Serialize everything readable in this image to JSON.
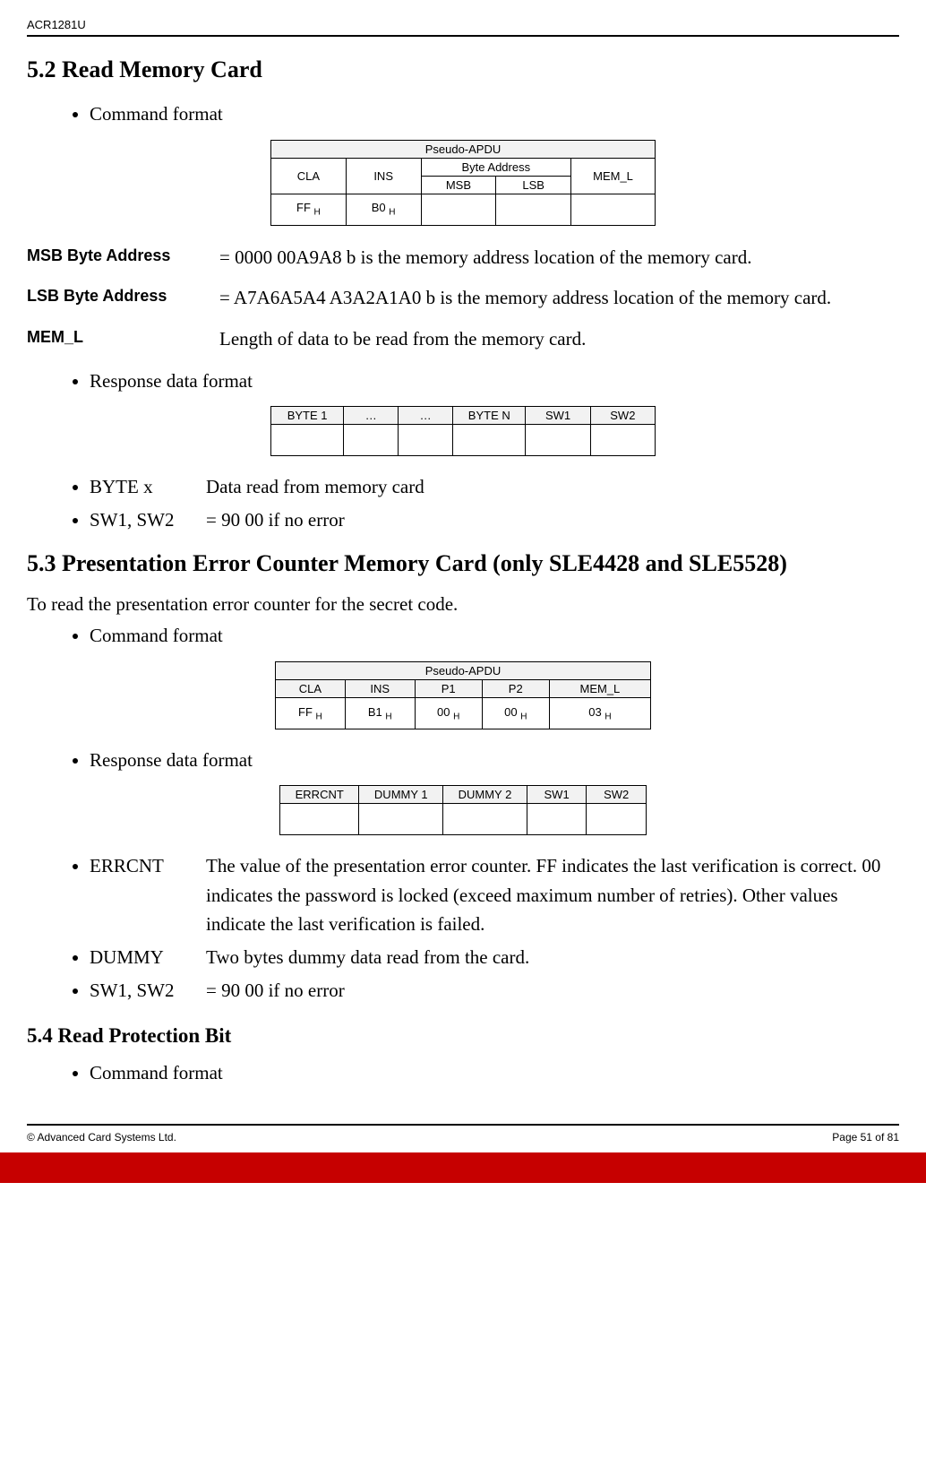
{
  "header": {
    "product": "ACR1281U"
  },
  "s52": {
    "heading": "5.2 Read Memory Card",
    "bullet_cmd": "Command format",
    "table1": {
      "caption": "Pseudo-APDU",
      "cols": {
        "cla": "CLA",
        "ins": "INS",
        "byteaddr": "Byte Address",
        "msb": "MSB",
        "lsb": "LSB",
        "meml": "MEM_L"
      },
      "row": {
        "cla": "FF",
        "clah": "H",
        "ins": "B0",
        "insh": "H"
      }
    },
    "defs": {
      "msb_label": "MSB Byte Address",
      "msb_text": "= 0000 00A9A8 b is the memory address location of the memory card.",
      "lsb_label": "LSB Byte Address",
      "lsb_text": "= A7A6A5A4 A3A2A1A0 b is the memory address location of the memory card.",
      "meml_label": "MEM_L",
      "meml_text": "Length of data to be read from the memory card."
    },
    "bullet_resp": "Response data format",
    "table2": {
      "h1": "BYTE 1",
      "h2": "…",
      "h3": "…",
      "h4": "BYTE N",
      "h5": "SW1",
      "h6": "SW2"
    },
    "notes": {
      "byte_l": "BYTE x",
      "byte_t": "Data read from memory card",
      "sw_l": "SW1, SW2",
      "sw_t": "= 90  00 if no error"
    }
  },
  "s53": {
    "heading": "5.3 Presentation Error Counter Memory Card (only SLE4428 and SLE5528)",
    "intro": "To read the presentation error counter for the secret code.",
    "bullet_cmd": "Command format",
    "table3": {
      "caption": "Pseudo-APDU",
      "cols": {
        "cla": "CLA",
        "ins": "INS",
        "p1": "P1",
        "p2": "P2",
        "meml": "MEM_L"
      },
      "row": {
        "cla": "FF",
        "ins": "B1",
        "p1": "00",
        "p2": "00",
        "meml": "03",
        "h": "H"
      }
    },
    "bullet_resp": "Response data format",
    "table4": {
      "h1": "ERRCNT",
      "h2": "DUMMY 1",
      "h3": "DUMMY 2",
      "h4": "SW1",
      "h5": "SW2"
    },
    "notes": {
      "err_l": "ERRCNT",
      "err_t": "The value of the presentation error counter.  FF indicates the last verification is correct.  00 indicates the password is locked (exceed maximum number of retries).  Other values indicate the last verification is failed.",
      "dum_l": "DUMMY",
      "dum_t": "Two bytes dummy data read from the card.",
      "sw_l": "SW1, SW2",
      "sw_t": "= 90  00  if no error"
    }
  },
  "s54": {
    "heading": "5.4 Read Protection Bit",
    "bullet_cmd": "Command format"
  },
  "footer": {
    "left": "© Advanced Card Systems Ltd.",
    "right": "Page 51 of 81"
  }
}
